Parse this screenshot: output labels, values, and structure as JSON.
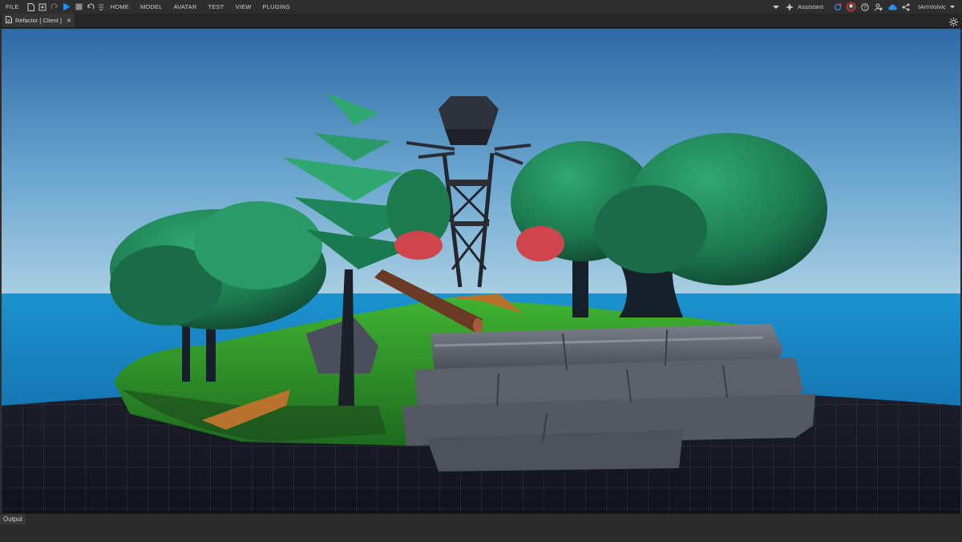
{
  "menu": {
    "file": "FILE",
    "tabs": [
      "HOME",
      "MODEL",
      "AVATAR",
      "TEST",
      "VIEW",
      "PLUGINS"
    ]
  },
  "toolbar": {
    "assistant_label": "Assistant",
    "username": "IAmVolvic"
  },
  "document_tab": {
    "title": "Refactor [ Client ]",
    "close": "✕"
  },
  "status": {
    "output_label": "Output"
  },
  "colors": {
    "accent": "#1f8fff",
    "menu_bg": "#2e2e2e",
    "sky_top": "#2d6aa6",
    "ocean": "#1f8bc8",
    "foliage": "#1f7a52",
    "rock": "#5f636e"
  },
  "icons": [
    "new-file-icon",
    "open-file-icon",
    "redo-icon",
    "play-icon",
    "stop-icon",
    "undo-icon",
    "dropdown-icon",
    "assistant-icon",
    "sync-icon",
    "avatar",
    "help-icon",
    "user-settings-icon",
    "cloud-icon",
    "share-icon",
    "viewport-settings-icon"
  ]
}
